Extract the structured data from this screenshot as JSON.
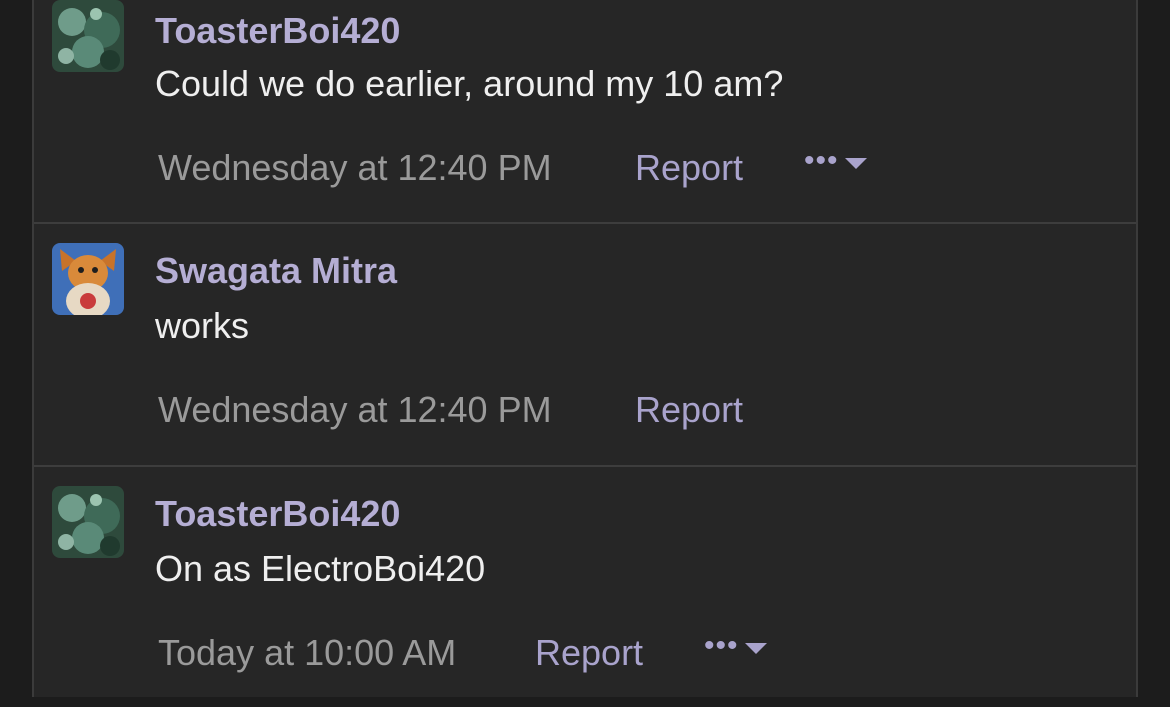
{
  "messages": [
    {
      "author": "ToasterBoi420",
      "text": "Could we do earlier, around my 10 am?",
      "time": "Wednesday at 12:40 PM",
      "report_label": "Report",
      "more_label": "•••",
      "avatar_icon": "green-moss-avatar-icon"
    },
    {
      "author": "Swagata Mitra",
      "text": "works",
      "time": "Wednesday at 12:40 PM",
      "report_label": "Report",
      "avatar_icon": "raichu-avatar-icon"
    },
    {
      "author": "ToasterBoi420",
      "text": "On as ElectroBoi420",
      "time": "Today at 10:00 AM",
      "report_label": "Report",
      "more_label": "•••",
      "avatar_icon": "green-moss-avatar-icon"
    }
  ],
  "colors": {
    "page_bg": "#1c1c1c",
    "post_bg": "#262626",
    "author": "#b5aed4",
    "link": "#a9a3cc",
    "body_text": "#efefef",
    "meta_text": "#9a9a9a"
  }
}
